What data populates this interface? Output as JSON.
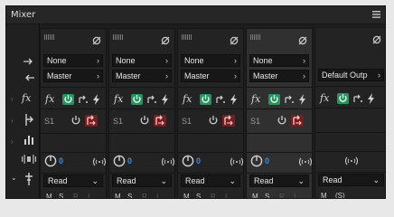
{
  "title": "Mixer",
  "icons": {
    "panel_menu": "hamburger-icon",
    "input_arrow": "arrow-right-icon",
    "output_arrow": "arrow-left-icon",
    "effects": "fx-icon",
    "sends": "send-icon",
    "eq": "eq-bars-icon",
    "pan": "stereo-pan-icon",
    "insert": "insert-icon"
  },
  "colors": {
    "power_green": "#1f9a5c",
    "record_red": "#7a1c1c",
    "knob_blue": "#3a8fe0"
  },
  "channels": [
    {
      "input": "None",
      "output": "Master",
      "send": "S1",
      "pan_value": "0",
      "read": "Read",
      "m": "M",
      "s": "S",
      "r": "R",
      "i": "I"
    },
    {
      "input": "None",
      "output": "Master",
      "send": "S1",
      "pan_value": "0",
      "read": "Read",
      "m": "M",
      "s": "S",
      "r": "R",
      "i": "I"
    },
    {
      "input": "None",
      "output": "Master",
      "send": "S1",
      "pan_value": "0",
      "read": "Read",
      "m": "M",
      "s": "S",
      "r": "R",
      "i": "I"
    },
    {
      "input": "None",
      "output": "Master",
      "send": "S1",
      "pan_value": "0",
      "read": "Read",
      "m": "M",
      "s": "S",
      "r": "R",
      "i": "I"
    }
  ],
  "master": {
    "output": "Default Outp",
    "read": "Read",
    "m": "M",
    "s": "(S)"
  }
}
